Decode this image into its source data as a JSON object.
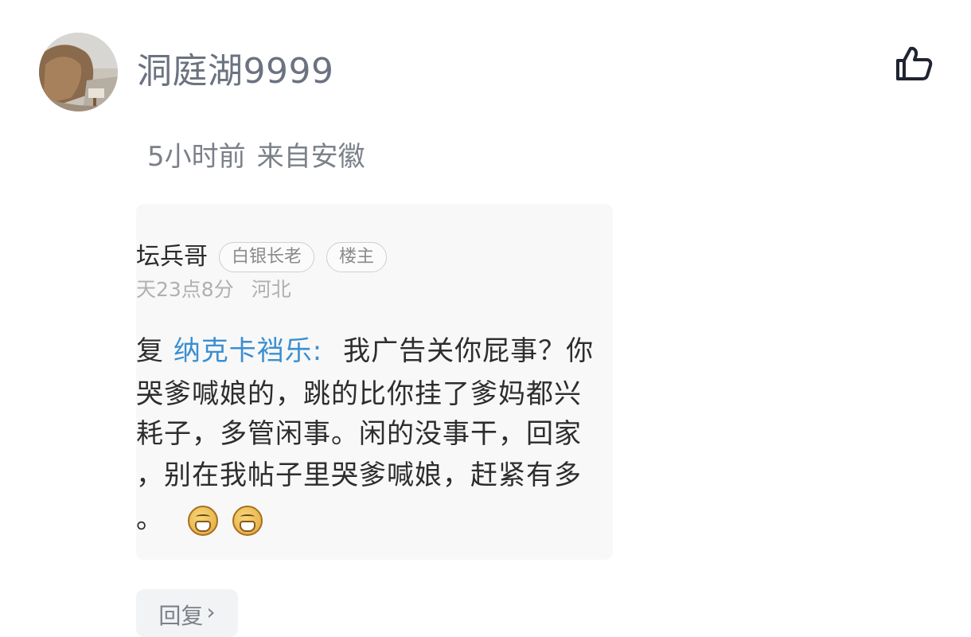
{
  "comment": {
    "username": "洞庭湖9999",
    "time": "5小时前",
    "location": "来自安徽"
  },
  "quoted_post": {
    "author_name": "坛兵哥",
    "badges": [
      "白银长老",
      "楼主"
    ],
    "time": "天23点8分",
    "location": "河北",
    "reply_prefix": "复",
    "mention": "纳克卡裆乐:",
    "lines": [
      "我广告关你屁事？你",
      "哭爹喊娘的，跳的比你挂了爹妈都兴",
      "耗子，多管闲事。闲的没事干，回家",
      "，别在我帖子里哭爹喊娘，赶紧有多",
      "。"
    ]
  },
  "actions": {
    "reply_label": "回复",
    "reply_chevron": "›"
  },
  "icons": {
    "like": "thumbs-up-icon",
    "emoji": "grin-emoji-icon"
  }
}
